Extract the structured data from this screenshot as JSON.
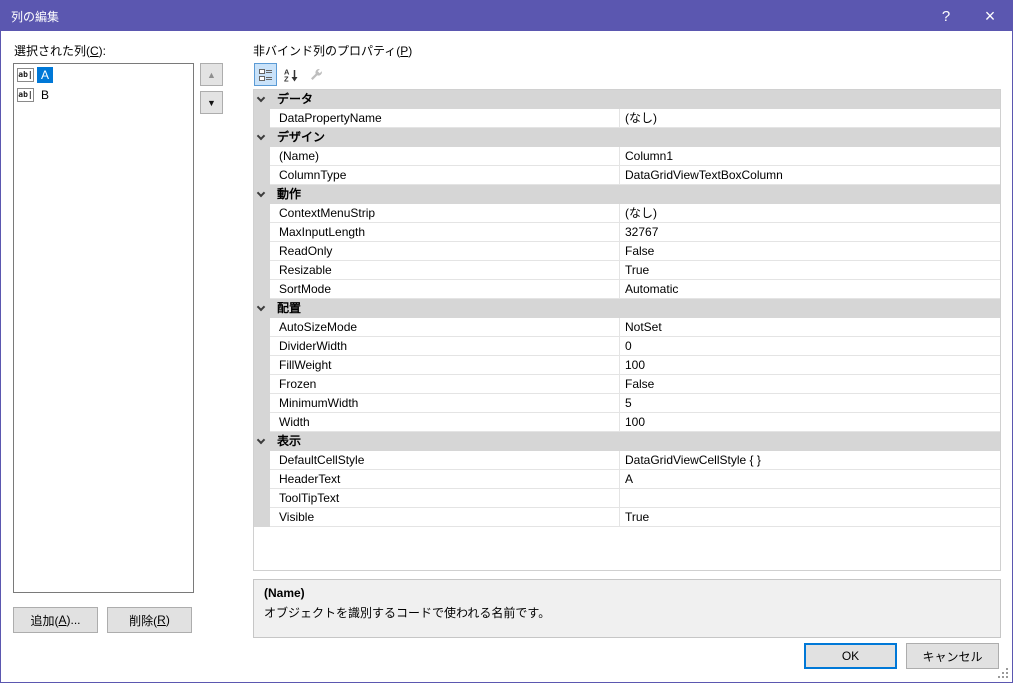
{
  "titlebar": {
    "title": "列の編集"
  },
  "icons": {
    "help": "?",
    "close": "×",
    "up_arrow": "▲",
    "down_arrow": "▼",
    "textbox_column": "ab|"
  },
  "left": {
    "label": {
      "pre": "選択された列(",
      "key": "C",
      "post": "):"
    },
    "items": [
      {
        "text": "A",
        "selected": true
      },
      {
        "text": "B",
        "selected": false
      }
    ],
    "buttons": {
      "add": {
        "pre": "追加(",
        "key": "A",
        "post": ")..."
      },
      "remove": {
        "pre": "削除(",
        "key": "R",
        "post": ")"
      }
    }
  },
  "properties": {
    "label": {
      "pre": "非バインド列のプロパティ(",
      "key": "P",
      "post": ")"
    },
    "groups": [
      {
        "category": "データ",
        "rows": [
          {
            "name": "DataPropertyName",
            "value": "(なし)"
          }
        ]
      },
      {
        "category": "デザイン",
        "rows": [
          {
            "name": "(Name)",
            "value": "Column1"
          },
          {
            "name": "ColumnType",
            "value": "DataGridViewTextBoxColumn"
          }
        ]
      },
      {
        "category": "動作",
        "rows": [
          {
            "name": "ContextMenuStrip",
            "value": "(なし)"
          },
          {
            "name": "MaxInputLength",
            "value": "32767"
          },
          {
            "name": "ReadOnly",
            "value": "False"
          },
          {
            "name": "Resizable",
            "value": "True"
          },
          {
            "name": "SortMode",
            "value": "Automatic"
          }
        ]
      },
      {
        "category": "配置",
        "rows": [
          {
            "name": "AutoSizeMode",
            "value": "NotSet"
          },
          {
            "name": "DividerWidth",
            "value": "0"
          },
          {
            "name": "FillWeight",
            "value": "100"
          },
          {
            "name": "Frozen",
            "value": "False"
          },
          {
            "name": "MinimumWidth",
            "value": "5"
          },
          {
            "name": "Width",
            "value": "100"
          }
        ]
      },
      {
        "category": "表示",
        "rows": [
          {
            "name": "DefaultCellStyle",
            "value": "DataGridViewCellStyle { }"
          },
          {
            "name": "HeaderText",
            "value": "A"
          },
          {
            "name": "ToolTipText",
            "value": ""
          },
          {
            "name": "Visible",
            "value": "True"
          }
        ]
      }
    ],
    "description": {
      "title": "(Name)",
      "text": "オブジェクトを識別するコードで使われる名前です。"
    }
  },
  "footer": {
    "ok": "OK",
    "cancel": "キャンセル"
  }
}
